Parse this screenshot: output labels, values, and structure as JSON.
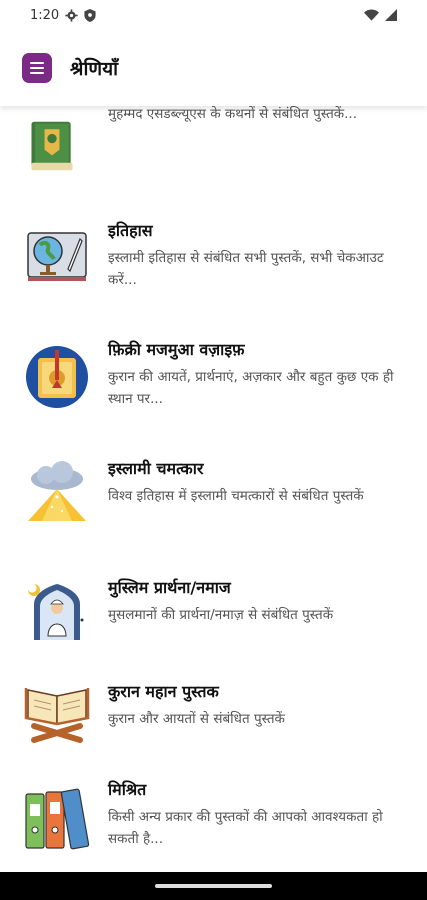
{
  "status_bar": {
    "time": "1:20"
  },
  "app_bar": {
    "title": "श्रेणियाँ"
  },
  "categories": [
    {
      "title": "",
      "description": "मुहम्मद एसडब्ल्यूएस के कथनों से संबंधित पुस्तकें...",
      "icon": "hadith-book-icon"
    },
    {
      "title": "इतिहास",
      "description": "इस्लामी इतिहास से संबंधित सभी पुस्तकें, सभी चेकआउट करें...",
      "icon": "globe-map-icon"
    },
    {
      "title": "फ़िक्री मजमुआ वज़ाइफ़",
      "description": "कुरान की आयतें, प्रार्थनाएं, अज़कार और बहुत कुछ एक ही स्थान पर...",
      "icon": "prayer-book-icon"
    },
    {
      "title": "इस्लामी चमत्कार",
      "description": "विश्व इतिहास में इस्लामी चमत्कारों से संबंधित पुस्तकें",
      "icon": "miracle-cloud-icon"
    },
    {
      "title": "मुस्लिम प्रार्थना/नमाज",
      "description": "मुसलमानों की प्रार्थना/नमाज़ से संबंधित पुस्तकें",
      "icon": "praying-person-icon"
    },
    {
      "title": "कुरान महान पुस्तक",
      "description": "कुरान और आयतों से संबंधित पुस्तकें",
      "icon": "quran-stand-icon"
    },
    {
      "title": "मिश्रित",
      "description": "किसी अन्य प्रकार की पुस्तकों की आपको आवश्यकता हो सकती है...",
      "icon": "binders-icon"
    }
  ]
}
